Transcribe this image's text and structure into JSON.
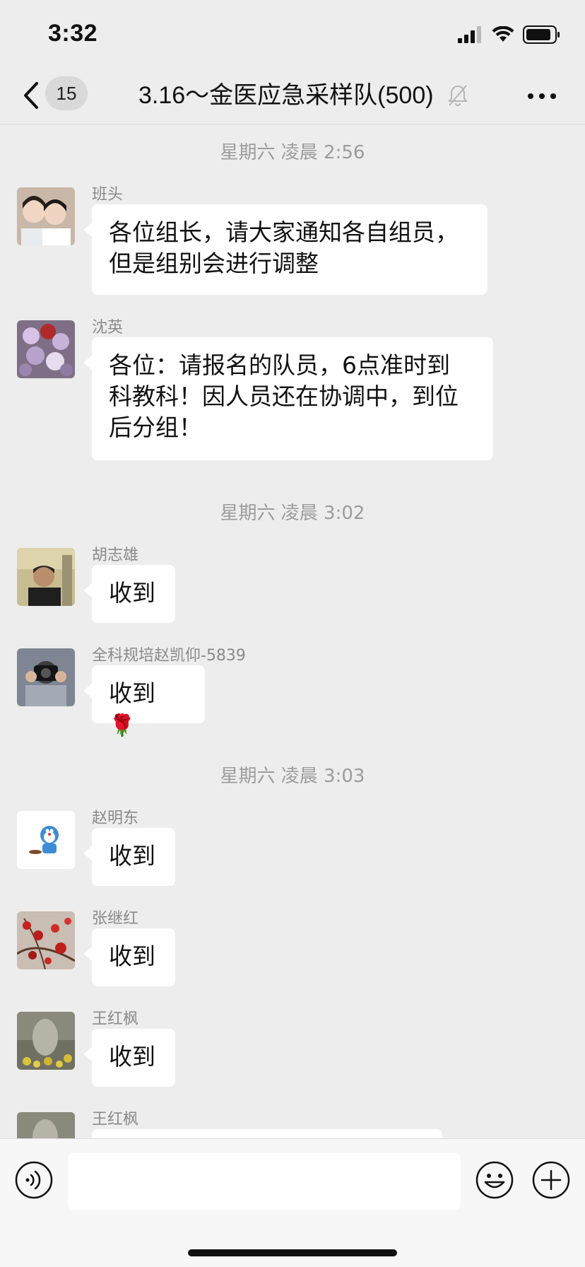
{
  "status_bar": {
    "time": "3:32"
  },
  "nav": {
    "unread_count": "15",
    "title": "3.16～金医应急采样队(500)"
  },
  "messages": [
    {
      "time": "星期六 凌晨 2:56"
    },
    {
      "sender": "班头",
      "text": "各位组长，请大家通知各自组员，\n但是组别会进行调整"
    },
    {
      "sender": "沈英",
      "text": "各位：请报名的队员，6点准时到\n科教科！因人员还在协调中，到位\n后分组！"
    },
    {
      "time": "星期六 凌晨 3:02"
    },
    {
      "sender": "胡志雄",
      "text": "收到"
    },
    {
      "sender": "全科规培赵凯仰-5839",
      "text": "收到",
      "emoji": "🌹"
    },
    {
      "time": "星期六 凌晨 3:03"
    },
    {
      "sender": "赵明东",
      "text": "收到"
    },
    {
      "sender": "张继红",
      "text": "收到"
    },
    {
      "sender": "王红枫",
      "text": "收到"
    },
    {
      "sender": "王红枫",
      "text": ""
    }
  ],
  "input": {
    "placeholder": ""
  },
  "colors": {
    "background": "#ededed",
    "bubble": "#ffffff",
    "timestamp": "#9c9c9c"
  }
}
